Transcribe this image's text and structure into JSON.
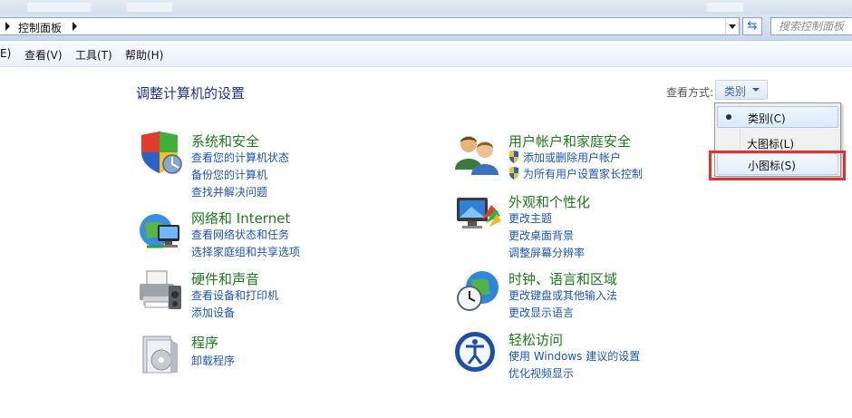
{
  "address": {
    "breadcrumb": "控制面板",
    "search_placeholder": "搜索控制面板",
    "refresh_icon": "refresh-icon"
  },
  "menu": {
    "items": [
      "E)",
      "查看(V)",
      "工具(T)",
      "帮助(H)"
    ]
  },
  "main": {
    "title": "调整计算机的设置"
  },
  "view_by": {
    "label": "查看方式:",
    "current": "类别",
    "options": [
      {
        "label": "类别(C)",
        "checked": true
      },
      {
        "label": "大图标(L)",
        "checked": false
      },
      {
        "label": "小图标(S)",
        "checked": false,
        "highlighted": true
      }
    ]
  },
  "categories": [
    {
      "id": "security",
      "icon": "shield-icon",
      "title": "系统和安全",
      "links": [
        "查看您的计算机状态",
        "备份您的计算机",
        "查找并解决问题"
      ]
    },
    {
      "id": "network",
      "icon": "network-icon",
      "title": "网络和 Internet",
      "links": [
        "查看网络状态和任务",
        "选择家庭组和共享选项"
      ]
    },
    {
      "id": "hardware",
      "icon": "printer-icon",
      "title": "硬件和声音",
      "links": [
        "查看设备和打印机",
        "添加设备"
      ]
    },
    {
      "id": "programs",
      "icon": "programs-icon",
      "title": "程序",
      "links": [
        "卸载程序"
      ]
    },
    {
      "id": "users",
      "icon": "users-icon",
      "title": "用户帐户和家庭安全",
      "links": [
        "添加或删除用户帐户",
        "为所有用户设置家长控制"
      ]
    },
    {
      "id": "appearance",
      "icon": "monitor-icon",
      "title": "外观和个性化",
      "links": [
        "更改主题",
        "更改桌面背景",
        "调整屏幕分辨率"
      ]
    },
    {
      "id": "clock",
      "icon": "globe-clock-icon",
      "title": "时钟、语言和区域",
      "links": [
        "更改键盘或其他输入法",
        "更改显示语言"
      ]
    },
    {
      "id": "access",
      "icon": "ease-of-access-icon",
      "title": "轻松访问",
      "links": [
        "使用 Windows 建议的设置",
        "优化视频显示"
      ]
    }
  ],
  "colors": {
    "category_title": "#1d7a1d",
    "link": "#1d56b3",
    "page_title": "#1e3287",
    "highlight": "#e03232"
  }
}
